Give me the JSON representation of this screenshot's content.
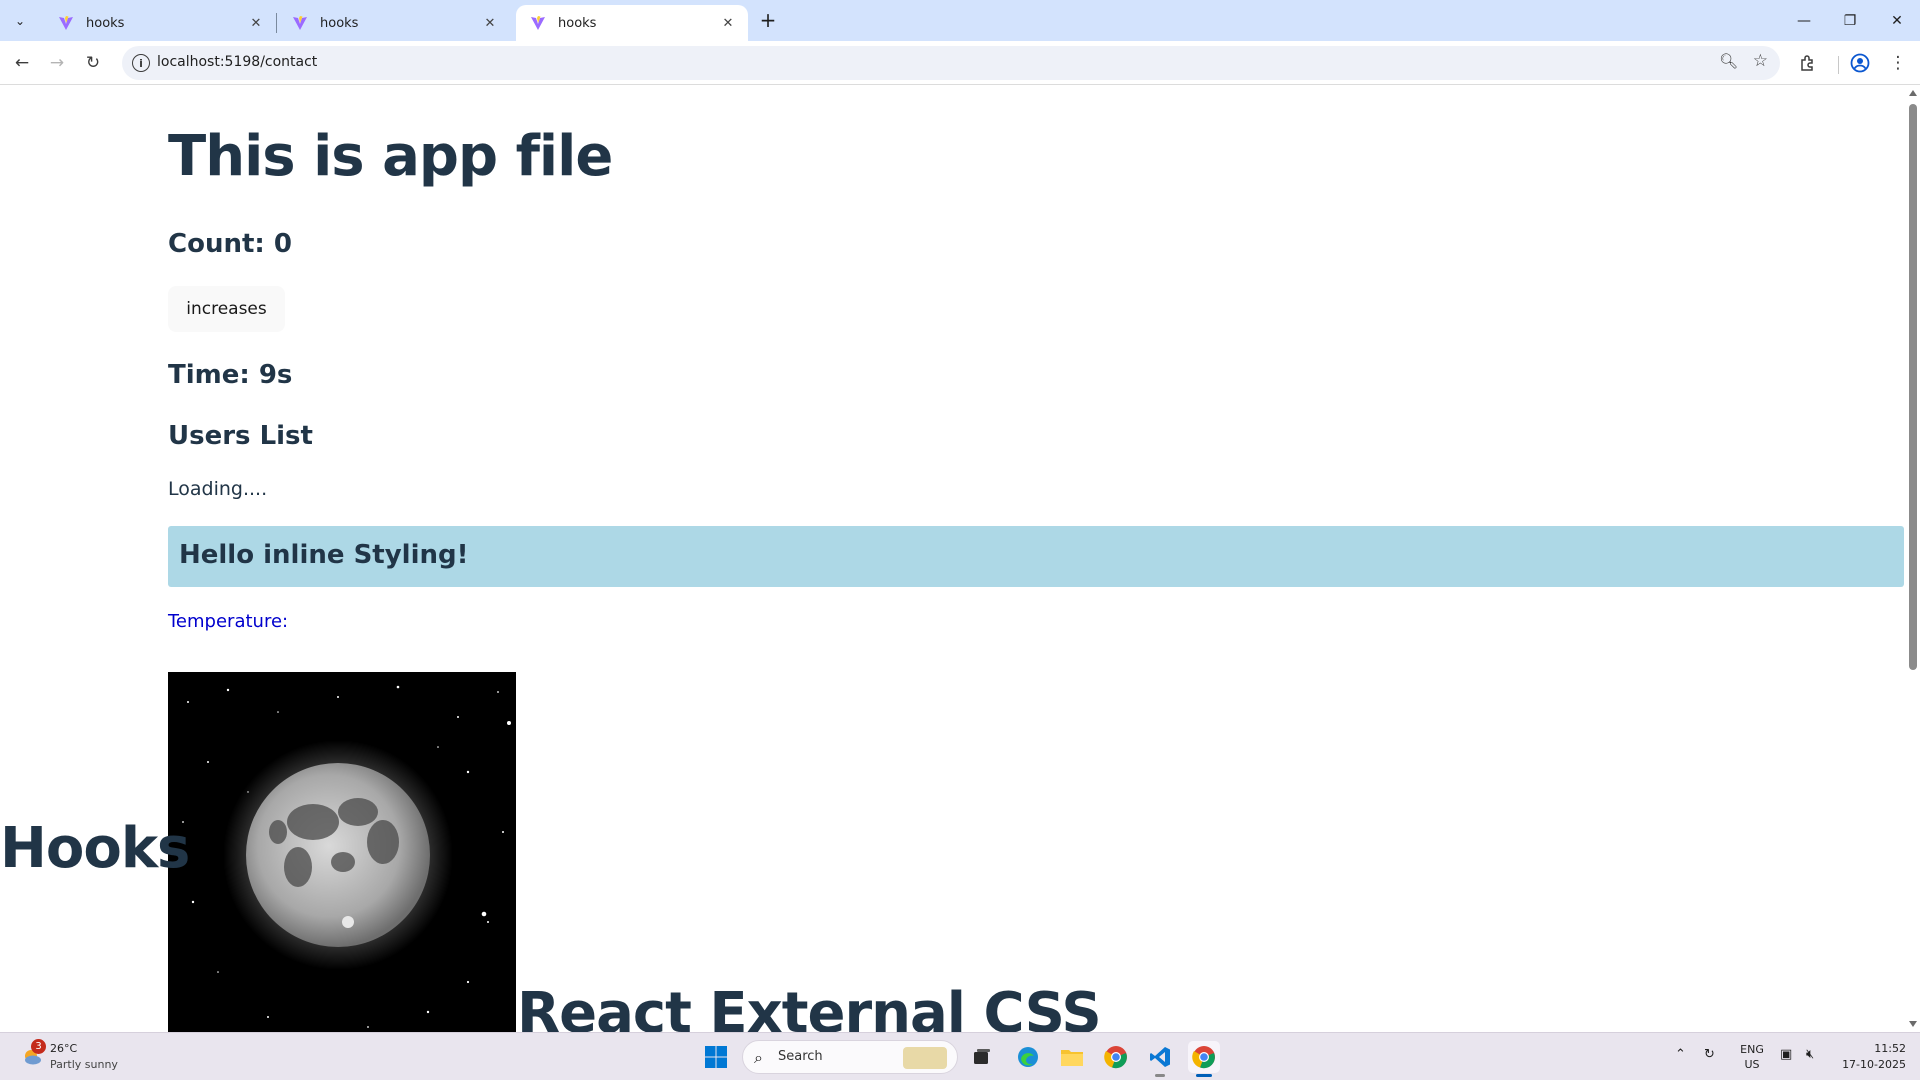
{
  "browser": {
    "tabs": [
      {
        "title": "hooks",
        "active": false
      },
      {
        "title": "hooks",
        "active": false
      },
      {
        "title": "hooks",
        "active": true
      }
    ],
    "url": "localhost:5198/contact"
  },
  "page": {
    "heading": "This is app file",
    "count_text": "Count: 0",
    "increase_button": "increases",
    "time_text": "Time: 9s",
    "users_heading": "Users List",
    "loading_text": "Loading....",
    "inline_styled_text": "Hello inline Styling!",
    "inline_box_color": "#add8e6",
    "temperature_label": "Temperature:",
    "temperature_color": "#0000cd",
    "hooks_heading": "Hooks",
    "external_css_heading": "React External CSS",
    "text_color": "#213547"
  },
  "taskbar": {
    "weather_temp": "26°C",
    "weather_condition": "Partly sunny",
    "weather_badge": "3",
    "search_placeholder": "Search",
    "language": "ENG",
    "region": "US",
    "time": "11:52",
    "date": "17-10-2025"
  }
}
